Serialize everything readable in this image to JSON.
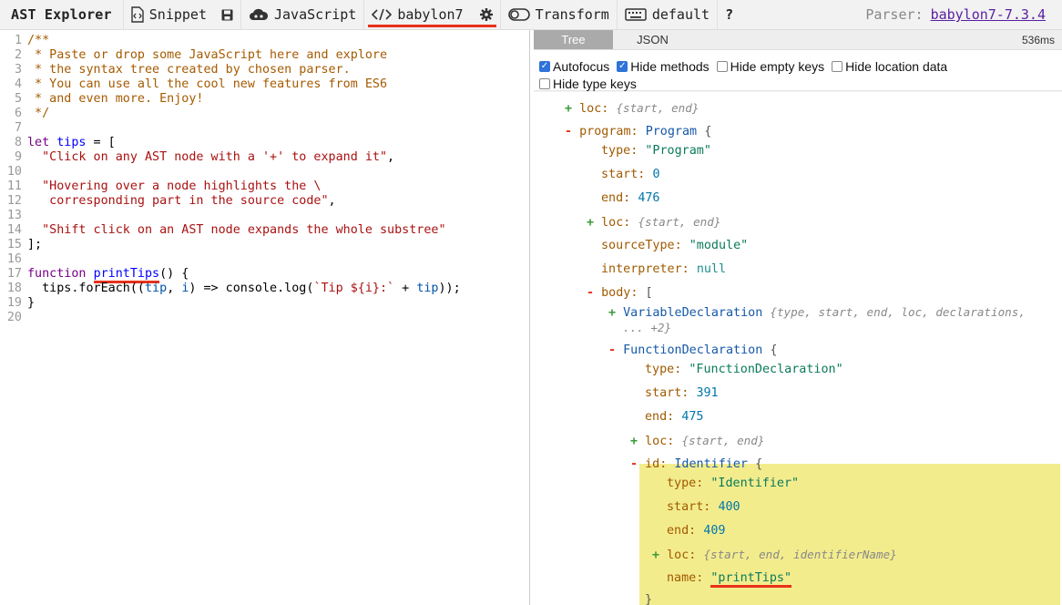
{
  "app": {
    "title": "AST Explorer"
  },
  "toolbar": {
    "snippet_label": "Snippet",
    "language_label": "JavaScript",
    "parser_label": "babylon7",
    "transform_label": "Transform",
    "keymap_label": "default",
    "help_label": "?",
    "parser_info_prefix": "Parser:",
    "parser_info_link": "babylon7-7.3.4"
  },
  "editor": {
    "lines": [
      [
        [
          "c-com",
          "/**"
        ]
      ],
      [
        [
          "c-com",
          " * Paste or drop some JavaScript here and explore"
        ]
      ],
      [
        [
          "c-com",
          " * the syntax tree created by chosen parser."
        ]
      ],
      [
        [
          "c-com",
          " * You can use all the cool new features from ES6"
        ]
      ],
      [
        [
          "c-com",
          " * and even more. Enjoy!"
        ]
      ],
      [
        [
          "c-com",
          " */"
        ]
      ],
      [],
      [
        [
          "c-kw",
          "let"
        ],
        [
          "c-var",
          " "
        ],
        [
          "c-def",
          "tips"
        ],
        [
          "c-var",
          " = ["
        ]
      ],
      [
        [
          "c-str",
          "  \"Click on any AST node with a '+' to expand it\""
        ],
        [
          "c-var",
          ","
        ]
      ],
      [],
      [
        [
          "c-str",
          "  \"Hovering over a node highlights the \\"
        ]
      ],
      [
        [
          "c-str",
          "   corresponding part in the source code\""
        ],
        [
          "c-var",
          ","
        ]
      ],
      [],
      [
        [
          "c-str",
          "  \"Shift click on an AST node expands the whole substree\""
        ]
      ],
      [
        [
          "c-var",
          "];"
        ]
      ],
      [],
      [
        [
          "c-kw",
          "function"
        ],
        [
          "c-var",
          " "
        ],
        [
          "c-def hl-underline",
          "printTips"
        ],
        [
          "c-var",
          "() {"
        ]
      ],
      [
        [
          "c-var",
          "  tips.forEach(("
        ],
        [
          "c-v2",
          "tip"
        ],
        [
          "c-var",
          ", "
        ],
        [
          "c-v2",
          "i"
        ],
        [
          "c-var",
          ") => console.log("
        ],
        [
          "c-str",
          "`Tip ${i}:`"
        ],
        [
          "c-var",
          " + "
        ],
        [
          "c-v2",
          "tip"
        ],
        [
          "c-var",
          "));"
        ]
      ],
      [
        [
          "c-var",
          "}"
        ]
      ],
      []
    ]
  },
  "output": {
    "tabs": [
      "Tree",
      "JSON"
    ],
    "active_tab": "Tree",
    "time": "536ms",
    "options": [
      {
        "label": "Autofocus",
        "checked": true
      },
      {
        "label": "Hide methods",
        "checked": true
      },
      {
        "label": "Hide empty keys",
        "checked": false
      },
      {
        "label": "Hide location data",
        "checked": false
      },
      {
        "label": "Hide type keys",
        "checked": false
      }
    ]
  },
  "tree": {
    "loc_top": {
      "key": "loc:",
      "hint": "{start, end}"
    },
    "program": {
      "key": "program:",
      "type": "Program",
      "brace": "{"
    },
    "program_type": {
      "key": "type:",
      "value": "\"Program\""
    },
    "program_start": {
      "key": "start:",
      "value": "0"
    },
    "program_end": {
      "key": "end:",
      "value": "476"
    },
    "program_loc": {
      "key": "loc:",
      "hint": "{start, end}"
    },
    "source_type": {
      "key": "sourceType:",
      "value": "\"module\""
    },
    "interpreter": {
      "key": "interpreter:",
      "value": "null"
    },
    "body": {
      "key": "body:",
      "brace": "["
    },
    "var_decl": {
      "type": "VariableDeclaration",
      "hint1": "{type, start, end, loc, declarations,",
      "hint2": "... +2}"
    },
    "func_decl": {
      "type": "FunctionDeclaration",
      "brace": "{"
    },
    "func_type": {
      "key": "type:",
      "value": "\"FunctionDeclaration\""
    },
    "func_start": {
      "key": "start:",
      "value": "391"
    },
    "func_end": {
      "key": "end:",
      "value": "475"
    },
    "func_loc": {
      "key": "loc:",
      "hint": "{start, end}"
    },
    "id": {
      "key": "id:",
      "type": "Identifier",
      "brace": "{"
    },
    "id_type": {
      "key": "type:",
      "value": "\"Identifier\""
    },
    "id_start": {
      "key": "start:",
      "value": "400"
    },
    "id_end": {
      "key": "end:",
      "value": "409"
    },
    "id_loc": {
      "key": "loc:",
      "hint": "{start, end, identifierName}"
    },
    "id_name": {
      "key": "name:",
      "value": "\"printTips\""
    },
    "id_close": "}"
  }
}
